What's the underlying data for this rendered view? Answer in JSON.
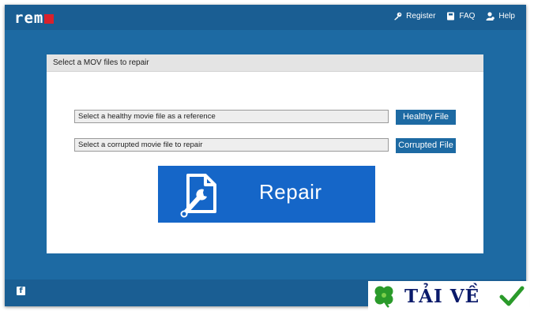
{
  "app": {
    "logo_text": "remo"
  },
  "nav": {
    "items": [
      {
        "label": "Register",
        "icon": "key-icon"
      },
      {
        "label": "FAQ",
        "icon": "book-icon"
      },
      {
        "label": "Help",
        "icon": "person-icon"
      }
    ]
  },
  "panel": {
    "title": "Select a MOV files to repair",
    "healthy_field": "Select a healthy movie file as a reference",
    "healthy_button": "Healthy File",
    "corrupted_field": "Select a corrupted movie file to repair",
    "corrupted_button": "Corrupted File",
    "repair_button": "Repair"
  },
  "footer": {
    "social_icon": "facebook-icon",
    "social_letter": "f"
  },
  "watermark": {
    "text": "TẢI VỀ",
    "icons": [
      "clover-icon",
      "checkmark-icon"
    ]
  },
  "colors": {
    "frame_blue": "#1d6aa3",
    "bar_blue": "#1a5e93",
    "repair_blue": "#1566c8",
    "logo_red": "#d9212b",
    "watermark_green": "#2a9a2a",
    "watermark_text": "#0a1a6a"
  }
}
